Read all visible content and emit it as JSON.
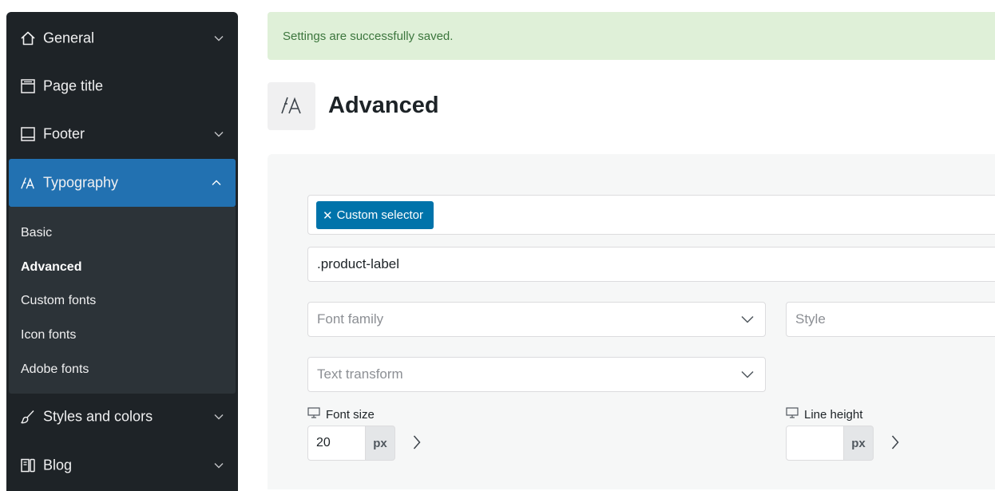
{
  "sidebar": {
    "items": [
      {
        "label": "General",
        "icon": "home-icon",
        "expandable": true
      },
      {
        "label": "Page title",
        "icon": "page-title-icon",
        "expandable": false
      },
      {
        "label": "Footer",
        "icon": "footer-icon",
        "expandable": true
      },
      {
        "label": "Typography",
        "icon": "typography-icon",
        "expandable": true,
        "active": true
      },
      {
        "label": "Styles and colors",
        "icon": "brush-icon",
        "expandable": true
      },
      {
        "label": "Blog",
        "icon": "blog-icon",
        "expandable": true
      }
    ],
    "submenu": [
      {
        "label": "Basic"
      },
      {
        "label": "Advanced",
        "current": true
      },
      {
        "label": "Custom fonts"
      },
      {
        "label": "Icon fonts"
      },
      {
        "label": "Adobe fonts"
      }
    ]
  },
  "notice": {
    "text": "Settings are successfully saved."
  },
  "page": {
    "title": "Advanced",
    "icon": "typography-icon"
  },
  "form": {
    "selector_tag": "Custom selector",
    "selector_value": ".product-label",
    "font_family_placeholder": "Font family",
    "style_placeholder": "Style",
    "text_transform_placeholder": "Text transform",
    "font_size": {
      "label": "Font size",
      "value": "20",
      "unit": "px",
      "device_icon": "desktop-icon"
    },
    "line_height": {
      "label": "Line height",
      "value": "",
      "unit": "px",
      "device_icon": "desktop-icon"
    }
  },
  "colors": {
    "sidebar_bg": "#1e2327",
    "active_bg": "#2271b1",
    "notice_bg": "#dff0d8",
    "notice_text": "#3c763d",
    "tag_bg": "#0073aa"
  }
}
